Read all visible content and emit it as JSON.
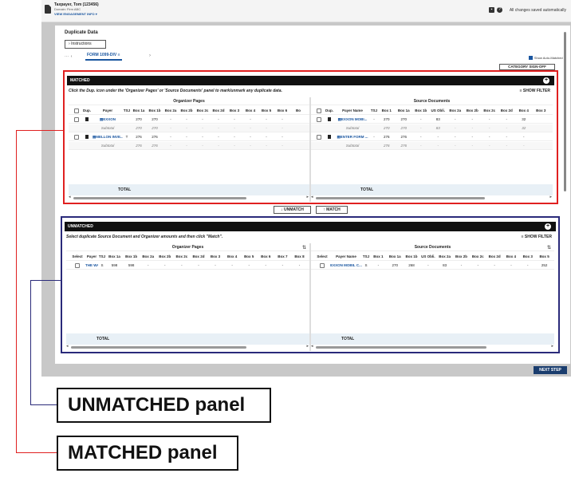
{
  "header": {
    "taxpayer": "Taxpayer, Tom (123456)",
    "domain": "Domain: Firm ABC",
    "view_info": "VIEW ENGAGEMENT INFO ▾",
    "saved_status": "All changes saved automatically"
  },
  "section": {
    "title": "Duplicate Data",
    "instructions_label": "Instructions",
    "more": "···",
    "tab_label": "FORM 1099-DIV",
    "auto_matched_label": "Show Auto-Matched",
    "category_signoff": "CATEGORY SIGN-OFF"
  },
  "matched": {
    "title": "MATCHED",
    "description": "Click the Dup. icon under the 'Organizer Pages' or 'Source Documents' panel to mark/unmark any duplicate data.",
    "show_filter": "SHOW FILTER",
    "organizer_group": "Organizer Pages",
    "source_group": "Source Documents",
    "left_columns": [
      "Dup.",
      "Payer",
      "TSJ",
      "Box 1a",
      "Box 1b",
      "Box 2a",
      "Box 2b",
      "Box 2c",
      "Box 2d",
      "Box 3",
      "Box 4",
      "Box 5",
      "Box 6",
      "Bo"
    ],
    "right_columns": [
      "Dup.",
      "Payer Name",
      "TSJ",
      "Box 1",
      "Box 1a",
      "Box 1b",
      "US Obli.",
      "Box 2a",
      "Box 2b",
      "Box 2c",
      "Box 2d",
      "Box 4",
      "Box 3"
    ],
    "left_rows": [
      {
        "payer": "EXXON",
        "tsj": "",
        "cells": [
          "270",
          "270",
          "-",
          "-",
          "-",
          "-",
          "-",
          "-",
          "-",
          "-"
        ]
      },
      {
        "payer": "Subtotal",
        "sub": true,
        "cells": [
          "270",
          "270",
          "-",
          "-",
          "-",
          "-",
          "-",
          "-",
          "-",
          "-"
        ]
      },
      {
        "payer": "MELLON INVE...",
        "tsj": "T",
        "cells": [
          "276",
          "276",
          "-",
          "-",
          "-",
          "-",
          "-",
          "-",
          "-",
          "-"
        ]
      },
      {
        "payer": "Subtotal",
        "sub": true,
        "cells": [
          "276",
          "276",
          "-",
          "-",
          "-",
          "-",
          "-",
          "-",
          "-",
          "-"
        ]
      }
    ],
    "right_rows": [
      {
        "payer": "EXXON MOBI...",
        "tsj": "-",
        "cells": [
          "270",
          "270",
          "-",
          "83",
          "-",
          "-",
          "-",
          "-",
          "32"
        ]
      },
      {
        "payer": "Subtotal",
        "sub": true,
        "cells": [
          "270",
          "270",
          "-",
          "83",
          "-",
          "-",
          "-",
          "-",
          "32"
        ]
      },
      {
        "payer": "ENTER FORM ...",
        "tsj": "-",
        "cells": [
          "276",
          "276",
          "-",
          "-",
          "-",
          "-",
          "-",
          "-",
          "-"
        ]
      },
      {
        "payer": "Subtotal",
        "sub": true,
        "cells": [
          "276",
          "276",
          "-",
          "-",
          "-",
          "-",
          "-",
          "-",
          "-"
        ]
      }
    ],
    "total_label": "TOTAL"
  },
  "actions": {
    "unmatch": "UNMATCH",
    "match": "MATCH"
  },
  "unmatched": {
    "title": "UNMATCHED",
    "description": "Select duplicate Source Document and Organizer amounts and then click \"Match\".",
    "show_filter": "SHOW FILTER",
    "organizer_group": "Organizer Pages",
    "source_group": "Source Documents",
    "left_columns": [
      "Select",
      "Payer",
      "TSJ",
      "Box 1a",
      "Box 1b",
      "Box 2a",
      "Box 2b",
      "Box 2c",
      "Box 2d",
      "Box 3",
      "Box 4",
      "Box 5",
      "Box 6",
      "Box 7",
      "Box 8"
    ],
    "right_columns": [
      "Select",
      "Payer Name",
      "TSJ",
      "Box 1",
      "Box 1a",
      "Box 1b",
      "US Obli.",
      "Box 2a",
      "Box 2b",
      "Box 2c",
      "Box 2d",
      "Box 4",
      "Box 3",
      "Box 5"
    ],
    "left_rows": [
      {
        "payer": "THE WALT DISNE...",
        "tsj": "S",
        "cells": [
          "598",
          "598",
          "-",
          "-",
          "-",
          "-",
          "-",
          "-",
          "-",
          "-",
          "-",
          "-"
        ]
      }
    ],
    "right_rows": [
      {
        "payer": "EXXON MOBIL C...",
        "tsj": "S",
        "cells": [
          "-",
          "270",
          "268",
          "-",
          "83",
          "-",
          "-",
          "-",
          "-",
          "-",
          "252",
          "-"
        ]
      }
    ],
    "total_label": "TOTAL"
  },
  "footer": {
    "next_step": "NEXT STEP"
  },
  "callouts": {
    "unmatched": "UNMATCHED panel",
    "matched": "MATCHED panel"
  },
  "colors": {
    "matched_border": "#e02020",
    "unmatched_border": "#2a2a7a",
    "link": "#1a56a0"
  }
}
